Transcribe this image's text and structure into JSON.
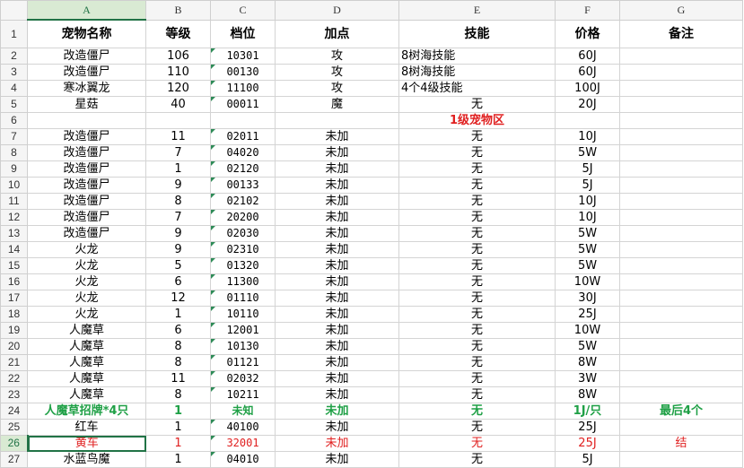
{
  "columns": [
    "A",
    "B",
    "C",
    "D",
    "E",
    "F",
    "G"
  ],
  "header_row": [
    "宠物名称",
    "等级",
    "档位",
    "加点",
    "技能",
    "价格",
    "备注"
  ],
  "rows": [
    {
      "n": "2",
      "cells": [
        "改造僵尸",
        "106",
        "10301",
        "攻",
        "8树海技能",
        "60J",
        ""
      ]
    },
    {
      "n": "3",
      "cells": [
        "改造僵尸",
        "110",
        "00130",
        "攻",
        "8树海技能",
        "60J",
        ""
      ]
    },
    {
      "n": "4",
      "cells": [
        "寒冰翼龙",
        "120",
        "11100",
        "攻",
        "4个4级技能",
        "100J",
        ""
      ]
    },
    {
      "n": "5",
      "cells": [
        "星菇",
        "40",
        "00011",
        "魔",
        "无",
        "20J",
        ""
      ]
    },
    {
      "n": "6",
      "cells": [
        "",
        "",
        "",
        "",
        "1级宠物区",
        "",
        ""
      ]
    },
    {
      "n": "7",
      "cells": [
        "改造僵尸",
        "11",
        "02011",
        "未加",
        "无",
        "10J",
        ""
      ]
    },
    {
      "n": "8",
      "cells": [
        "改造僵尸",
        "7",
        "04020",
        "未加",
        "无",
        "5W",
        ""
      ]
    },
    {
      "n": "9",
      "cells": [
        "改造僵尸",
        "1",
        "02120",
        "未加",
        "无",
        "5J",
        ""
      ]
    },
    {
      "n": "10",
      "cells": [
        "改造僵尸",
        "9",
        "00133",
        "未加",
        "无",
        "5J",
        ""
      ]
    },
    {
      "n": "11",
      "cells": [
        "改造僵尸",
        "8",
        "02102",
        "未加",
        "无",
        "10J",
        ""
      ]
    },
    {
      "n": "12",
      "cells": [
        "改造僵尸",
        "7",
        "20200",
        "未加",
        "无",
        "10J",
        ""
      ]
    },
    {
      "n": "13",
      "cells": [
        "改造僵尸",
        "9",
        "02030",
        "未加",
        "无",
        "5W",
        ""
      ]
    },
    {
      "n": "14",
      "cells": [
        "火龙",
        "9",
        "02310",
        "未加",
        "无",
        "5W",
        ""
      ]
    },
    {
      "n": "15",
      "cells": [
        "火龙",
        "5",
        "01320",
        "未加",
        "无",
        "5W",
        ""
      ]
    },
    {
      "n": "16",
      "cells": [
        "火龙",
        "6",
        "11300",
        "未加",
        "无",
        "10W",
        ""
      ]
    },
    {
      "n": "17",
      "cells": [
        "火龙",
        "12",
        "01110",
        "未加",
        "无",
        "30J",
        ""
      ]
    },
    {
      "n": "18",
      "cells": [
        "火龙",
        "1",
        "10110",
        "未加",
        "无",
        "25J",
        ""
      ]
    },
    {
      "n": "19",
      "cells": [
        "人魔草",
        "6",
        "12001",
        "未加",
        "无",
        "10W",
        ""
      ]
    },
    {
      "n": "20",
      "cells": [
        "人魔草",
        "8",
        "10130",
        "未加",
        "无",
        "5W",
        ""
      ]
    },
    {
      "n": "21",
      "cells": [
        "人魔草",
        "8",
        "01121",
        "未加",
        "无",
        "8W",
        ""
      ]
    },
    {
      "n": "22",
      "cells": [
        "人魔草",
        "11",
        "02032",
        "未加",
        "无",
        "3W",
        ""
      ]
    },
    {
      "n": "23",
      "cells": [
        "人魔草",
        "8",
        "10211",
        "未加",
        "无",
        "8W",
        ""
      ]
    },
    {
      "n": "24",
      "cells": [
        "人魔草招牌*4只",
        "1",
        "未知",
        "未加",
        "无",
        "1J/只",
        "最后4个"
      ]
    },
    {
      "n": "25",
      "cells": [
        "红车",
        "1",
        "40100",
        "未加",
        "无",
        "25J",
        ""
      ]
    },
    {
      "n": "26",
      "cells": [
        "黄车",
        "1",
        "32001",
        "未加",
        "无",
        "25J",
        "结"
      ]
    },
    {
      "n": "27",
      "cells": [
        "水蓝鸟魔",
        "1",
        "04010",
        "未加",
        "无",
        "5J",
        ""
      ]
    }
  ],
  "colors": {
    "green": "#1fa046",
    "red": "#e02020",
    "selection": "#217346"
  }
}
